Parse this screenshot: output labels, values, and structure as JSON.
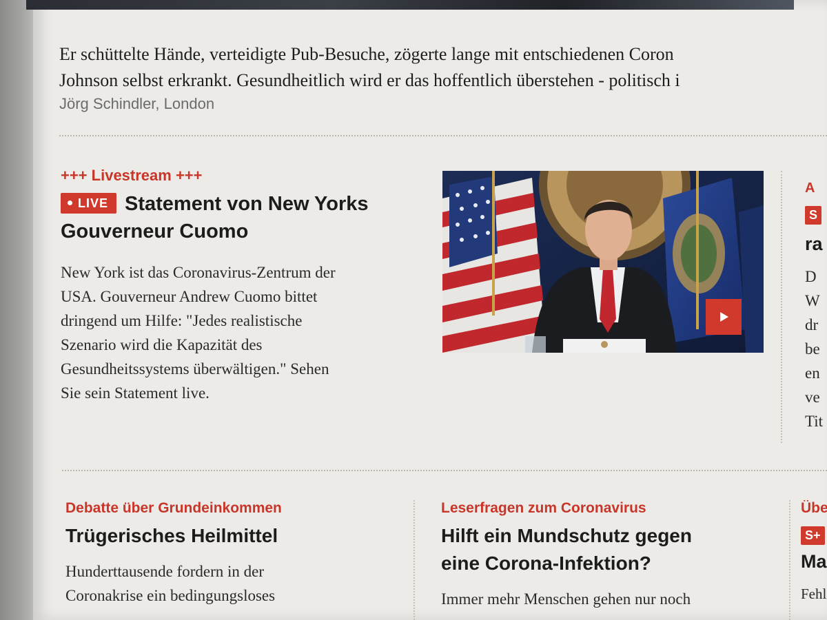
{
  "top_teaser": {
    "intro_line1": "Er schüttelte Hände, verteidigte Pub-Besuche, zögerte lange mit entschiedenen Coron",
    "intro_line2": "Johnson selbst erkrankt. Gesundheitlich wird er das hoffentlich überstehen - politisch i",
    "author": "Jörg Schindler, London"
  },
  "live_teaser": {
    "kicker": "+++ Livestream +++",
    "badge": "LIVE",
    "headline_line1": "Statement von New Yorks",
    "headline_line2": "Gouverneur Cuomo",
    "body_lines": [
      "New York ist das Coronavirus-Zentrum der",
      "USA. Gouverneur Andrew Cuomo bittet",
      "dringend um Hilfe: \"Jedes realistische",
      "Szenario wird die Kapazität des",
      "Gesundheitssystems überwältigen.\" Sehen",
      "Sie sein Statement live."
    ],
    "video_icon": "play-icon"
  },
  "right_column_partial": {
    "kicker": "A",
    "badge": "S",
    "headline": "ra",
    "body_lines": [
      "D",
      "W",
      "dr",
      "be",
      "en",
      "ve",
      "Tit"
    ]
  },
  "bottom_teasers": [
    {
      "kicker": "Debatte über Grundeinkommen",
      "headline": "Trügerisches Heilmittel",
      "body_lines": [
        "Hunderttausende fordern in der",
        "Coronakrise ein bedingungsloses"
      ]
    },
    {
      "kicker": "Leserfragen zum Coronavirus",
      "headline_line1": "Hilft ein Mundschutz gegen",
      "headline_line2": "eine Corona-Infektion?",
      "body_lines": [
        "Immer mehr Menschen gehen nur noch"
      ]
    },
    {
      "kicker": "Übe",
      "badge": "S+",
      "headline": "Ma",
      "body_lines": [
        "Fehl"
      ]
    }
  ],
  "colors": {
    "accent": "#cf3a2c",
    "page_bg": "#ecebe7",
    "text": "#1c1c1c"
  }
}
